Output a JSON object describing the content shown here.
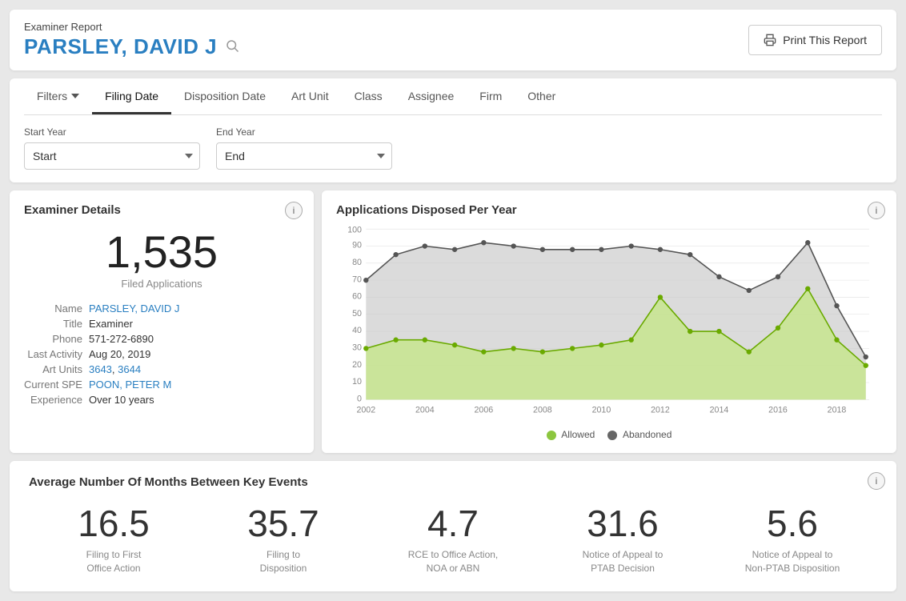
{
  "header": {
    "report_label": "Examiner Report",
    "examiner_name": "PARSLEY, DAVID J",
    "print_button": "Print This Report"
  },
  "filters": {
    "tabs": [
      {
        "id": "filters",
        "label": "Filters",
        "active": false,
        "toggle": true
      },
      {
        "id": "filing-date",
        "label": "Filing Date",
        "active": true
      },
      {
        "id": "disposition-date",
        "label": "Disposition Date",
        "active": false
      },
      {
        "id": "art-unit",
        "label": "Art Unit",
        "active": false
      },
      {
        "id": "class",
        "label": "Class",
        "active": false
      },
      {
        "id": "assignee",
        "label": "Assignee",
        "active": false
      },
      {
        "id": "firm",
        "label": "Firm",
        "active": false
      },
      {
        "id": "other",
        "label": "Other",
        "active": false
      }
    ],
    "start_year_label": "Start Year",
    "end_year_label": "End Year",
    "start_year_placeholder": "Start",
    "end_year_placeholder": "End"
  },
  "examiner": {
    "card_title": "Examiner Details",
    "filed_count": "1,535",
    "filed_label": "Filed Applications",
    "name_label": "Name",
    "name_value": "PARSLEY, DAVID J",
    "title_label": "Title",
    "title_value": "Examiner",
    "phone_label": "Phone",
    "phone_value": "571-272-6890",
    "last_activity_label": "Last Activity",
    "last_activity_value": "Aug 20, 2019",
    "art_units_label": "Art Units",
    "art_unit_1": "3643",
    "art_unit_2": "3644",
    "spe_label": "Current SPE",
    "spe_value": "POON, PETER M",
    "experience_label": "Experience",
    "experience_value": "Over 10 years"
  },
  "chart": {
    "title": "Applications Disposed Per Year",
    "legend_allowed": "Allowed",
    "legend_abandoned": "Abandoned",
    "allowed_color": "#8cc63f",
    "abandoned_color": "#aaaaaa",
    "years": [
      "2002",
      "2003",
      "2004",
      "2005",
      "2006",
      "2007",
      "2008",
      "2009",
      "2010",
      "2011",
      "2012",
      "2013",
      "2014",
      "2015",
      "2016",
      "2017",
      "2018",
      "2019"
    ],
    "abandoned_values": [
      70,
      85,
      90,
      88,
      92,
      90,
      88,
      88,
      88,
      90,
      88,
      85,
      72,
      64,
      72,
      92,
      55,
      25
    ],
    "allowed_values": [
      30,
      35,
      35,
      32,
      28,
      30,
      28,
      30,
      32,
      35,
      60,
      40,
      40,
      28,
      42,
      65,
      35,
      20
    ],
    "y_labels": [
      "0",
      "10",
      "20",
      "30",
      "40",
      "50",
      "60",
      "70",
      "80",
      "90",
      "100"
    ]
  },
  "stats": {
    "title": "Average Number Of Months Between Key Events",
    "items": [
      {
        "value": "16.5",
        "label": "Filing to First\nOffice Action"
      },
      {
        "value": "35.7",
        "label": "Filing to\nDisposition"
      },
      {
        "value": "4.7",
        "label": "RCE to Office Action,\nNOA or ABN"
      },
      {
        "value": "31.6",
        "label": "Notice of Appeal to\nPTAB Decision"
      },
      {
        "value": "5.6",
        "label": "Notice of Appeal to\nNon-PTAB Disposition"
      }
    ]
  }
}
